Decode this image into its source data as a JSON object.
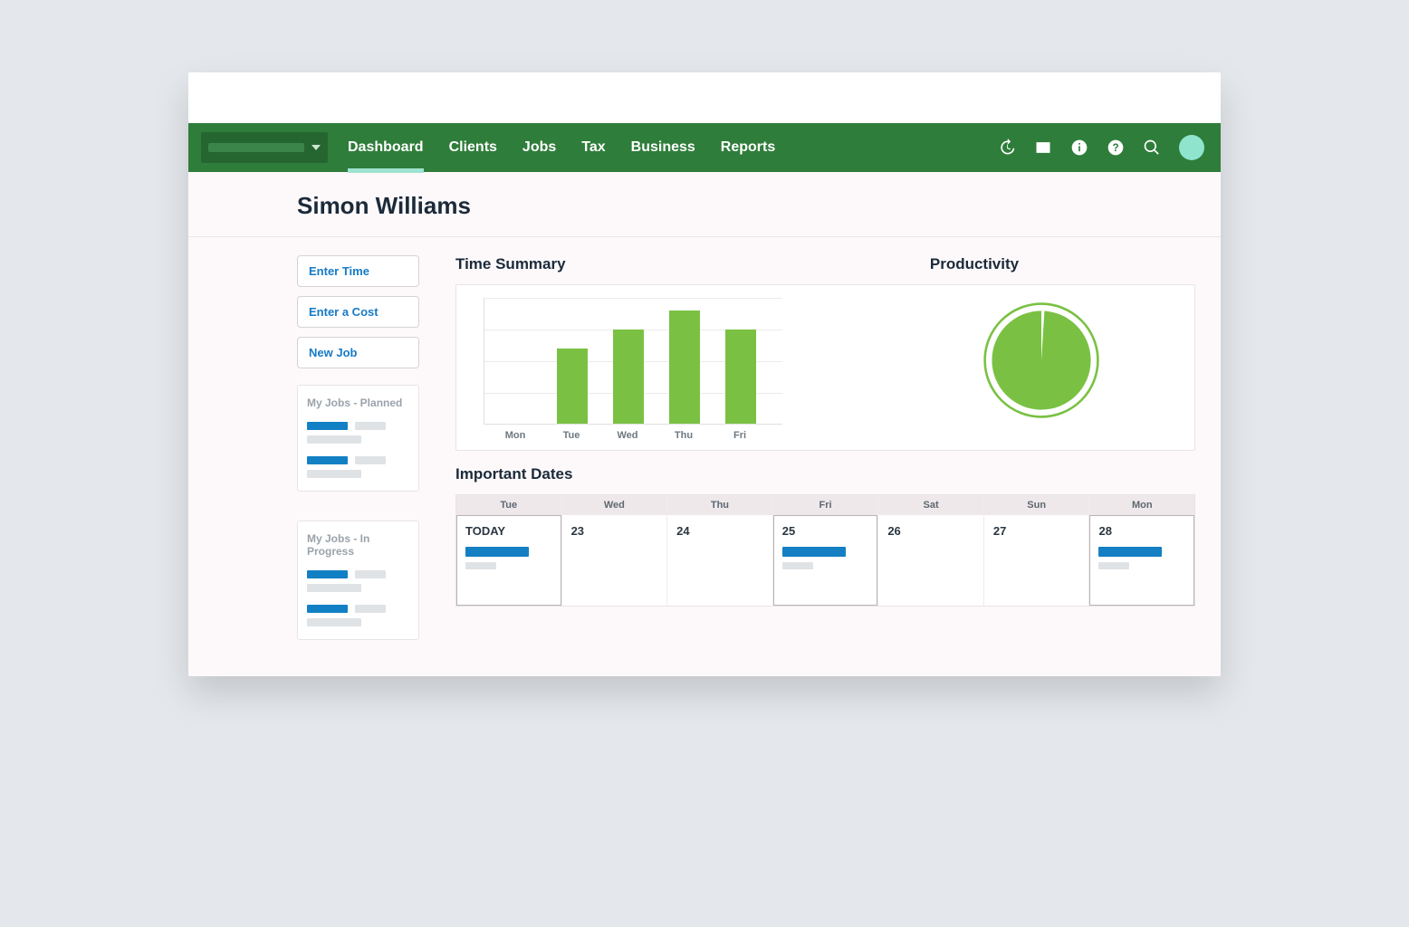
{
  "nav": {
    "items": [
      "Dashboard",
      "Clients",
      "Jobs",
      "Tax",
      "Business",
      "Reports"
    ],
    "active_index": 0
  },
  "page": {
    "title": "Simon Williams"
  },
  "sidebar": {
    "enter_time": "Enter Time",
    "enter_cost": "Enter a Cost",
    "new_job": "New Job",
    "panel_planned_title": "My Jobs - Planned",
    "panel_inprogress_title": "My Jobs - In Progress"
  },
  "sections": {
    "time_summary": "Time Summary",
    "productivity": "Productivity",
    "important_dates": "Important Dates"
  },
  "chart_data": {
    "type": "bar",
    "categories": [
      "Mon",
      "Tue",
      "Wed",
      "Thu",
      "Fri"
    ],
    "values": [
      0,
      60,
      75,
      90,
      75
    ],
    "ylim": [
      0,
      100
    ],
    "title": "Time Summary"
  },
  "productivity": {
    "percent": 99
  },
  "calendar": {
    "days": [
      {
        "dow": "Tue",
        "label": "TODAY",
        "active": true,
        "has_event": true
      },
      {
        "dow": "Wed",
        "label": "23",
        "active": false,
        "has_event": false
      },
      {
        "dow": "Thu",
        "label": "24",
        "active": false,
        "has_event": false
      },
      {
        "dow": "Fri",
        "label": "25",
        "active": true,
        "has_event": true
      },
      {
        "dow": "Sat",
        "label": "26",
        "active": false,
        "has_event": false
      },
      {
        "dow": "Sun",
        "label": "27",
        "active": false,
        "has_event": false
      },
      {
        "dow": "Mon",
        "label": "28",
        "active": true,
        "has_event": true
      }
    ]
  },
  "colors": {
    "brand_green": "#2f7d3a",
    "bar_green": "#7ac143",
    "link_blue": "#167ac6",
    "event_blue": "#157fc3"
  }
}
